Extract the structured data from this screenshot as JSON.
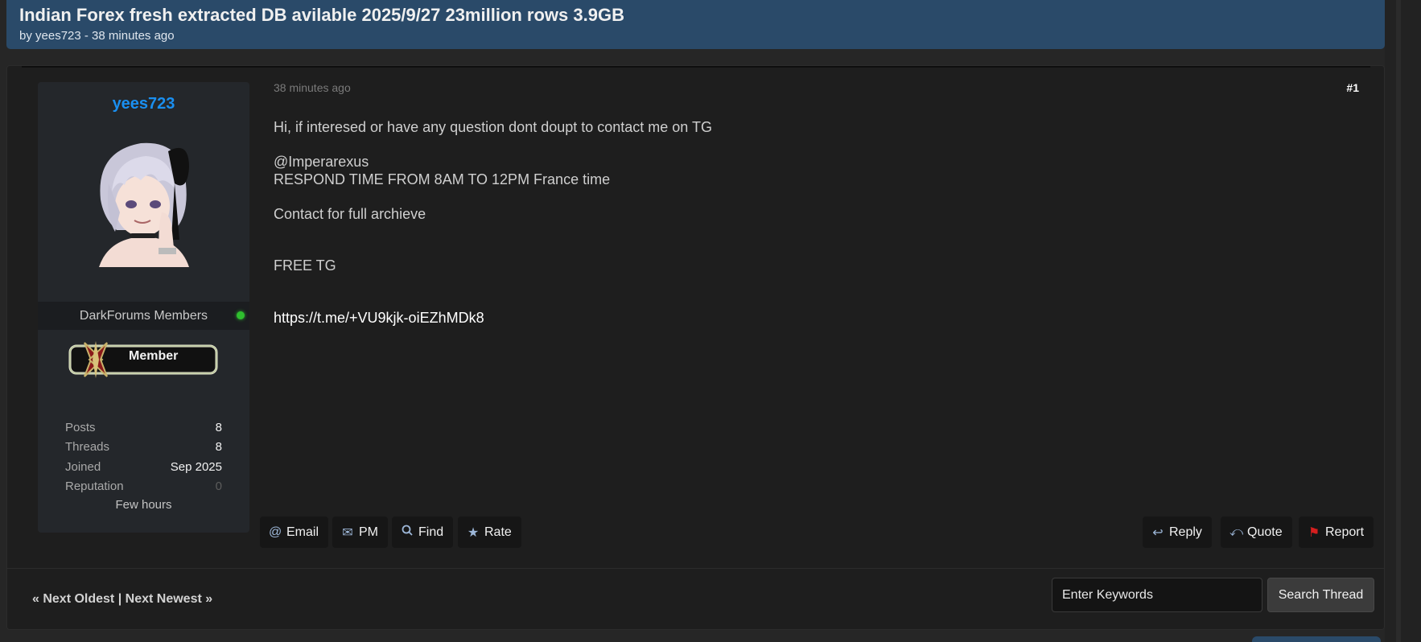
{
  "thread": {
    "title": "Indian Forex fresh extracted DB avilable 2025/9/27 23million rows 3.9GB",
    "meta": "by yees723 - 38 minutes ago"
  },
  "author": {
    "username": "yees723",
    "group": "DarkForums Members",
    "rank_badge": "Member",
    "stats": [
      {
        "label": "Posts",
        "value": "8"
      },
      {
        "label": "Threads",
        "value": "8"
      },
      {
        "label": "Joined",
        "value": "Sep 2025"
      },
      {
        "label": "Reputation",
        "value": "0"
      }
    ],
    "last_seen": "Few hours"
  },
  "post": {
    "date": "38 minutes ago",
    "number": "#1",
    "lines": {
      "l1": "Hi, if interesed or have any question dont doupt to contact me on TG",
      "l2": "@Imperarexus",
      "l3": "RESPOND TIME FROM 8AM TO 12PM France time",
      "l4": "Contact for full archieve",
      "l5": "FREE TG",
      "l6": "https://t.me/+VU9kjk-oiEZhMDk8"
    }
  },
  "actions": {
    "left": [
      {
        "label": "Email",
        "icon": "at-icon"
      },
      {
        "label": "PM",
        "icon": "envelope-icon"
      },
      {
        "label": "Find",
        "icon": "search-icon"
      },
      {
        "label": "Rate",
        "icon": "star-icon"
      }
    ],
    "right": [
      {
        "label": "Reply",
        "icon": "reply-icon"
      },
      {
        "label": "Quote",
        "icon": "quote-icon"
      },
      {
        "label": "Report",
        "icon": "flag-icon"
      }
    ]
  },
  "footer": {
    "next_oldest": "« Next Oldest",
    "separator": "|",
    "next_newest": "Next Newest »",
    "search_placeholder": "Enter Keywords",
    "search_button": "Search Thread"
  },
  "colors": {
    "header_bg": "#2a4a69",
    "username": "#1a8ff0",
    "online": "#2fbf2f",
    "report_flag": "#d61f1f"
  }
}
